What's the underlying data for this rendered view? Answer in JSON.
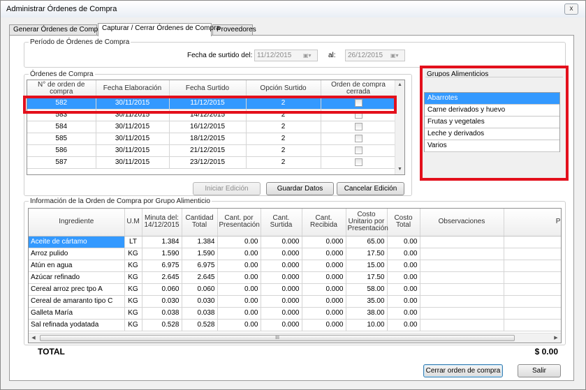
{
  "window": {
    "title": "Administrar Órdenes de Compra",
    "close_label": "x"
  },
  "tabs": [
    {
      "label": "Generar Órdenes de Compra."
    },
    {
      "label": "Capturar / Cerrar Órdenes de Compra"
    },
    {
      "label": "Proveedores"
    }
  ],
  "period": {
    "legend": "Período de Órdenes de Compra",
    "from_label": "Fecha de surtido del:",
    "from_value": "11/12/2015",
    "to_label": "al:",
    "to_value": "26/12/2015"
  },
  "orders": {
    "legend": "Órdenes de Compra",
    "columns": [
      "N° de orden de compra",
      "Fecha Elaboración",
      "Fecha Surtido",
      "Opción Surtido",
      "Orden de compra cerrada"
    ],
    "rows": [
      {
        "num": "582",
        "elab": "30/11/2015",
        "surt": "11/12/2015",
        "opc": "2"
      },
      {
        "num": "583",
        "elab": "30/11/2015",
        "surt": "14/12/2015",
        "opc": "2"
      },
      {
        "num": "584",
        "elab": "30/11/2015",
        "surt": "16/12/2015",
        "opc": "2"
      },
      {
        "num": "585",
        "elab": "30/11/2015",
        "surt": "18/12/2015",
        "opc": "2"
      },
      {
        "num": "586",
        "elab": "30/11/2015",
        "surt": "21/12/2015",
        "opc": "2"
      },
      {
        "num": "587",
        "elab": "30/11/2015",
        "surt": "23/12/2015",
        "opc": "2"
      }
    ],
    "selected_index": 0
  },
  "groups": {
    "legend": "Grupos Alimenticios",
    "items": [
      "Abarrotes",
      "Carne derivados y huevo",
      "Frutas y vegetales",
      "Leche y derivados",
      "Varios"
    ],
    "selected_index": 0
  },
  "actions": {
    "start_edit": "Iniciar Edición",
    "save": "Guardar Datos",
    "cancel_edit": "Cancelar Edición"
  },
  "info": {
    "legend": "Información de la Orden de Compra por Grupo Alimenticio",
    "columns": [
      "Ingrediente",
      "U.M",
      "Minuta del: 14/12/2015",
      "Cantidad Total",
      "Cant. por Presentación",
      "Cant. Surtida",
      "Cant. Recibida",
      "Costo Unitario por Presentación",
      "Costo Total",
      "Observaciones",
      "Proveedo"
    ],
    "rows": [
      {
        "ing": "Aceite de cártamo",
        "um": "LT",
        "minuta": "1.384",
        "total": "1.384",
        "pres": "0.00",
        "surt": "0.000",
        "rec": "0.000",
        "costo_u": "65.00",
        "costo_t": "0.00"
      },
      {
        "ing": "Arroz pulido",
        "um": "KG",
        "minuta": "1.590",
        "total": "1.590",
        "pres": "0.00",
        "surt": "0.000",
        "rec": "0.000",
        "costo_u": "17.50",
        "costo_t": "0.00"
      },
      {
        "ing": "Atún en agua",
        "um": "KG",
        "minuta": "6.975",
        "total": "6.975",
        "pres": "0.00",
        "surt": "0.000",
        "rec": "0.000",
        "costo_u": "15.00",
        "costo_t": "0.00"
      },
      {
        "ing": "Azúcar refinado",
        "um": "KG",
        "minuta": "2.645",
        "total": "2.645",
        "pres": "0.00",
        "surt": "0.000",
        "rec": "0.000",
        "costo_u": "17.50",
        "costo_t": "0.00"
      },
      {
        "ing": "Cereal arroz prec tpo A",
        "um": "KG",
        "minuta": "0.060",
        "total": "0.060",
        "pres": "0.00",
        "surt": "0.000",
        "rec": "0.000",
        "costo_u": "58.00",
        "costo_t": "0.00"
      },
      {
        "ing": "Cereal de amaranto tipo C",
        "um": "KG",
        "minuta": "0.030",
        "total": "0.030",
        "pres": "0.00",
        "surt": "0.000",
        "rec": "0.000",
        "costo_u": "35.00",
        "costo_t": "0.00"
      },
      {
        "ing": "Galleta María",
        "um": "KG",
        "minuta": "0.038",
        "total": "0.038",
        "pres": "0.00",
        "surt": "0.000",
        "rec": "0.000",
        "costo_u": "38.00",
        "costo_t": "0.00"
      },
      {
        "ing": "Sal refinada yodatada",
        "um": "KG",
        "minuta": "0.528",
        "total": "0.528",
        "pres": "0.00",
        "surt": "0.000",
        "rec": "0.000",
        "costo_u": "10.00",
        "costo_t": "0.00"
      }
    ],
    "selected_index": 0,
    "scroll_thumb_glyph": "III"
  },
  "footer": {
    "total_label": "TOTAL",
    "total_value": "$ 0.00",
    "close_order": "Cerrar orden de compra",
    "exit": "Salir"
  },
  "colors": {
    "selection": "#3399ff",
    "highlight": "#e3101c"
  }
}
